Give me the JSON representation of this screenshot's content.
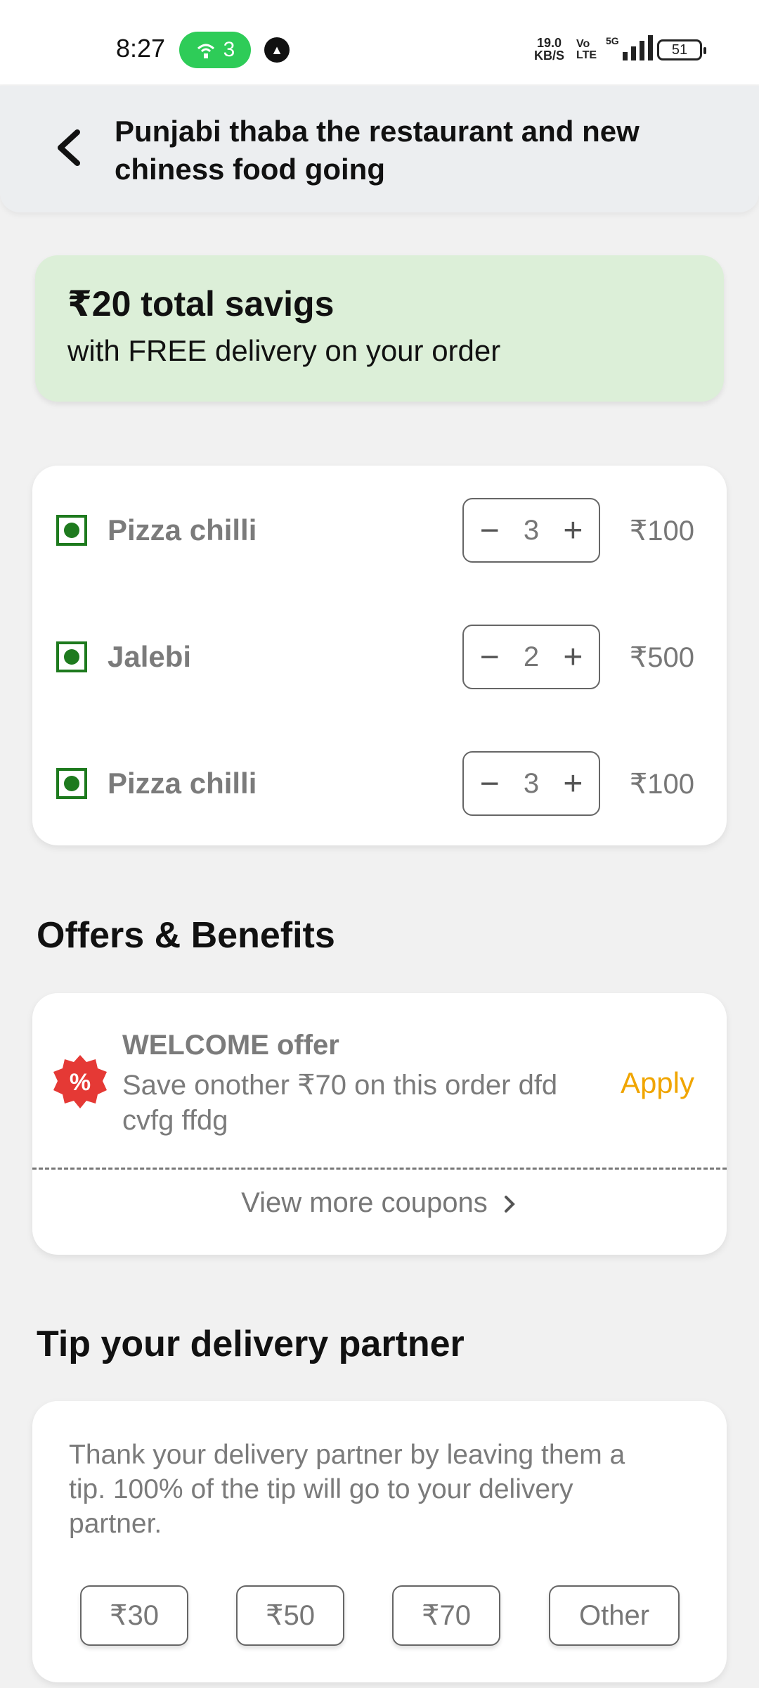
{
  "status_bar": {
    "time": "8:27",
    "hotspot_count": "3",
    "net_speed_value": "19.0",
    "net_speed_unit": "KB/S",
    "volte_top": "Vo",
    "volte_bottom": "LTE",
    "network_type": "5G",
    "battery": "51"
  },
  "header": {
    "title": "Punjabi thaba the restaurant and new chiness food going"
  },
  "savings": {
    "title": "₹20 total savigs",
    "subtitle": "with FREE delivery on your order"
  },
  "cart": {
    "items": [
      {
        "name": "Pizza chilli",
        "qty": "3",
        "price": "₹100"
      },
      {
        "name": "Jalebi",
        "qty": "2",
        "price": "₹500"
      },
      {
        "name": "Pizza chilli",
        "qty": "3",
        "price": "₹100"
      }
    ]
  },
  "offers": {
    "section_title": "Offers & Benefits",
    "offer_title": "WELCOME offer",
    "offer_desc": "Save onother ₹70 on this order dfd cvfg ffdg",
    "apply_label": "Apply",
    "more_label": "View more coupons"
  },
  "tip": {
    "section_title": "Tip your delivery partner",
    "description": "Thank your delivery partner by leaving them a tip. 100% of the tip will go to your delivery partner.",
    "options": [
      "₹30",
      "₹50",
      "₹70",
      "Other"
    ]
  },
  "colors": {
    "savings_bg": "#dcefd8",
    "veg_green": "#1e7a1e",
    "apply_orange": "#f0a500",
    "discount_red": "#e53935",
    "hotspot_green": "#2ecc58"
  }
}
